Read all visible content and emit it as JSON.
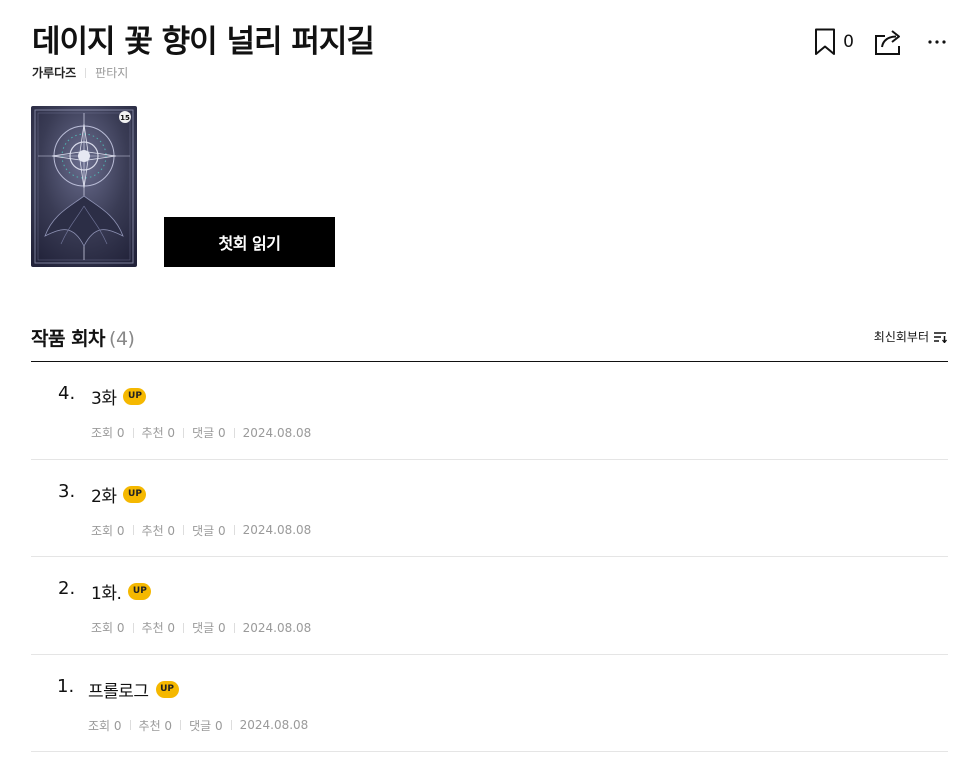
{
  "work": {
    "title": "데이지 꽃 향이 널리 퍼지길",
    "author": "가루다즈",
    "genre": "판타지",
    "bookmark_count": "0",
    "age_rating": "15",
    "first_episode_label": "첫회 읽기"
  },
  "icons": {
    "bookmark": "bookmark-icon",
    "share": "share-icon",
    "more": "more-icon",
    "sort": "sort-icon"
  },
  "colors": {
    "up_badge": "#f5b800",
    "primary_button": "#000000"
  },
  "episode_section": {
    "title": "작품 회차",
    "count": "(4)",
    "sort_label": "최신회부터"
  },
  "episodes": [
    {
      "number": "4.",
      "title": "3화",
      "badge": "UP",
      "views": "조회 0",
      "recommends": "추천 0",
      "comments": "댓글 0",
      "date": "2024.08.08"
    },
    {
      "number": "3.",
      "title": "2화",
      "badge": "UP",
      "views": "조회 0",
      "recommends": "추천 0",
      "comments": "댓글 0",
      "date": "2024.08.08"
    },
    {
      "number": "2.",
      "title": "1화.",
      "badge": "UP",
      "views": "조회 0",
      "recommends": "추천 0",
      "comments": "댓글 0",
      "date": "2024.08.08"
    },
    {
      "number": "1.",
      "title": "프롤로그",
      "badge": "UP",
      "views": "조회 0",
      "recommends": "추천 0",
      "comments": "댓글 0",
      "date": "2024.08.08"
    }
  ]
}
